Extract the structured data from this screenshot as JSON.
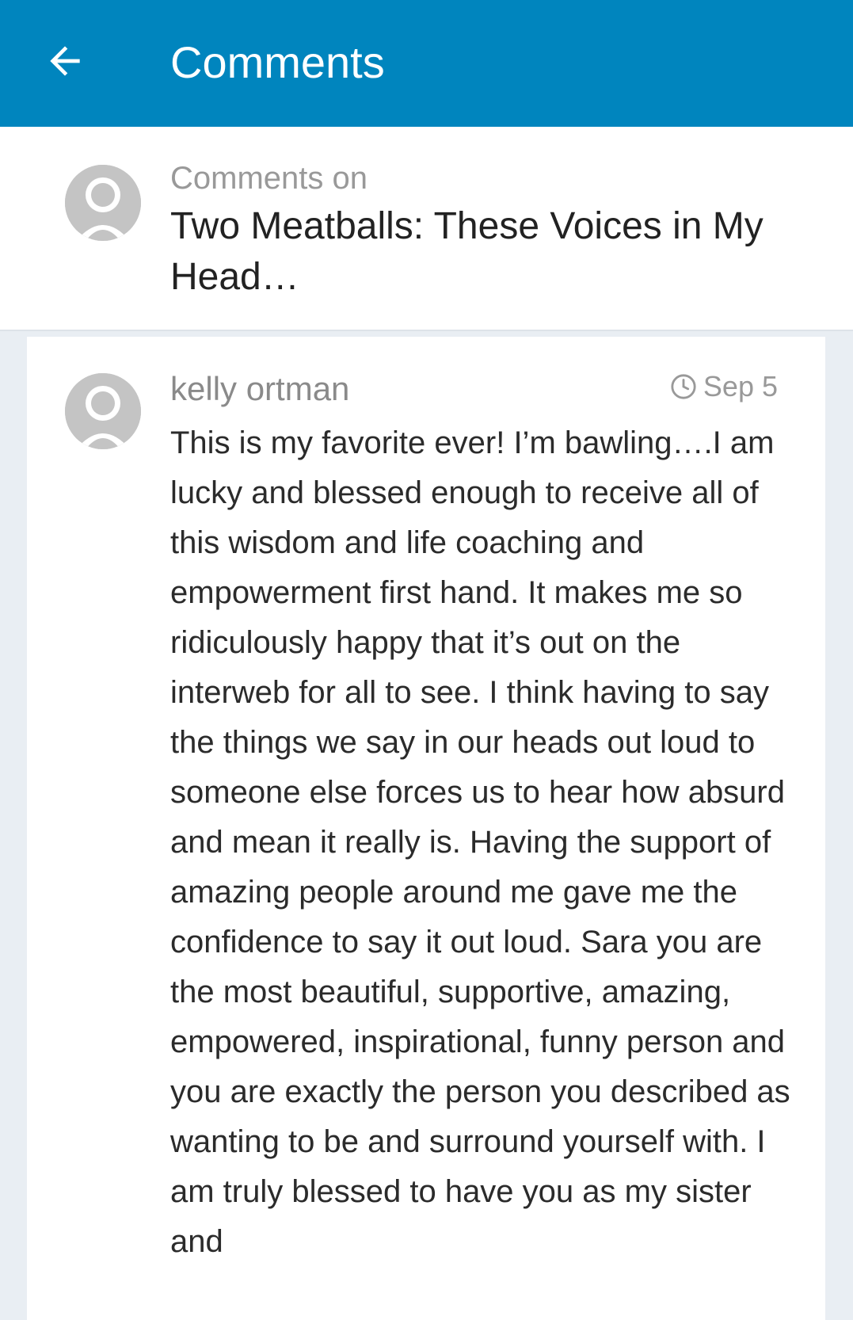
{
  "appbar": {
    "title": "Comments",
    "back_icon": "arrow-left-icon",
    "background": "#0085be"
  },
  "post": {
    "label": "Comments on",
    "title": "Two Meatballs: These Voices in My Head…",
    "avatar_icon": "default-avatar-icon"
  },
  "comment": {
    "author": "kelly ortman",
    "date": "Sep 5",
    "date_icon": "clock-icon",
    "avatar_icon": "default-avatar-icon",
    "body": "This is my favorite ever! I’m bawling….I am lucky and blessed enough to receive all of this wisdom and life coaching and empowerment first hand. It makes me so ridiculously happy that it’s out on the interweb for all to see. I think having to say the things we say in our heads out loud to someone else forces us to hear how absurd and mean it really is. Having the support of amazing people around me gave me the confidence to say it out loud. Sara you are the most beautiful, supportive, amazing, empowered, inspirational, funny person and you are exactly the person you described as wanting to be and surround yourself with. I am truly blessed to have you as my sister and"
  }
}
